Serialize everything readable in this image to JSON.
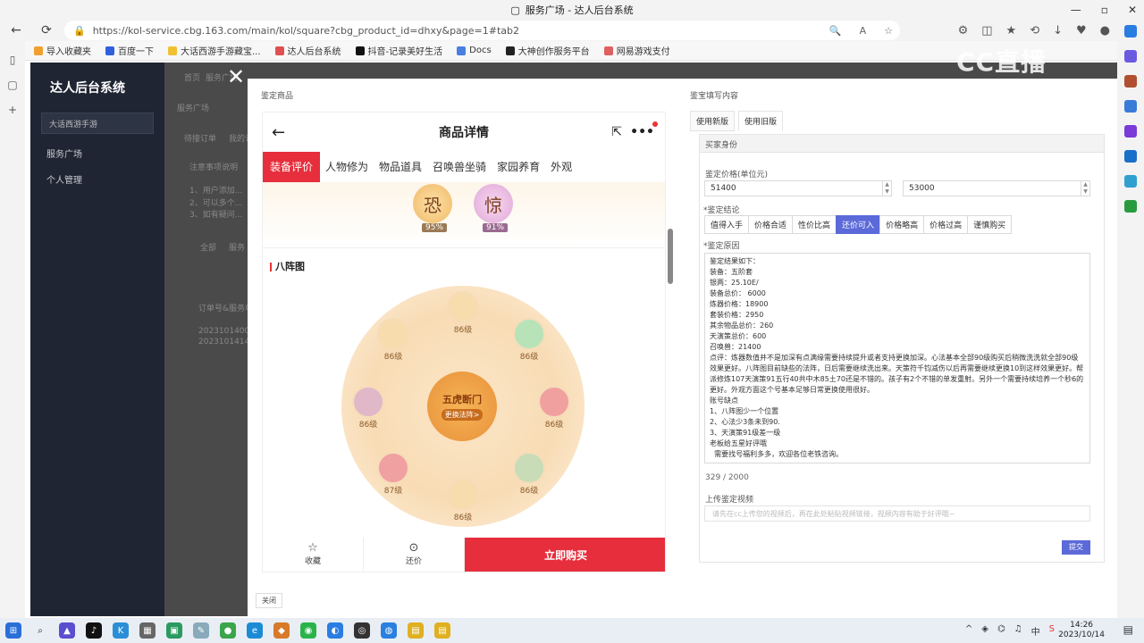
{
  "window": {
    "title": "服务广场 - 达人后台系统"
  },
  "browser": {
    "url": "https://kol-service.cbg.163.com/main/kol/square?cbg_product_id=dhxy&page=1#tab2",
    "bookmarks": [
      {
        "label": "导入收藏夹",
        "color": "#f0a030"
      },
      {
        "label": "百度一下",
        "color": "#3060e0"
      },
      {
        "label": "大话西游手游藏宝...",
        "color": "#f0c030"
      },
      {
        "label": "达人后台系统",
        "color": "#e05050"
      },
      {
        "label": "抖音-记录美好生活",
        "color": "#111111"
      },
      {
        "label": "Docs",
        "color": "#4a7ee0"
      },
      {
        "label": "大神创作服务平台",
        "color": "#222222"
      },
      {
        "label": "网易游戏支付",
        "color": "#e06060"
      }
    ]
  },
  "watermark": "CC直播",
  "sidebar": {
    "logo": "达人后台系统",
    "game_select": "大话西游手游",
    "items": [
      "服务广场",
      "个人管理"
    ]
  },
  "background_fragments": [
    "服务广场",
    "待接订单",
    "我的订",
    "注意事项说明",
    "1、用户添加...",
    "2、可以多个...",
    "3、如有疑问...",
    "全部",
    "服务",
    "订单号&服务单号",
    "2023101400...",
    "2023101414...",
    "首页",
    "服务广场",
    "待"
  ],
  "modal": {
    "left_title": "鉴定商品",
    "right_title": "鉴宝填写内容",
    "close_label": "关闭"
  },
  "phone": {
    "header_title": "商品详情",
    "tabs": [
      "装备评价",
      "人物修为",
      "物品道具",
      "召唤兽坐骑",
      "家园养育",
      "外观"
    ],
    "active_tab": 0,
    "emotions": [
      {
        "char": "恐",
        "pct": "95%"
      },
      {
        "char": "惊",
        "pct": "91%"
      }
    ],
    "section_title": "八阵图",
    "center": {
      "title": "五虎断门",
      "action": "更换法阵>"
    },
    "nodes": [
      "86级",
      "86级",
      "86级",
      "86级",
      "86级",
      "86级",
      "86级",
      "87级"
    ],
    "footer": {
      "fav": "收藏",
      "bargain": "还价",
      "buy": "立即购买"
    }
  },
  "form": {
    "tabs": [
      "使用新版",
      "使用旧版"
    ],
    "active_tab": 1,
    "panel_header": "买家身份",
    "price_label": "鉴定价格(单位元)",
    "price_min": "51400",
    "price_max": "53000",
    "conclusion_label": "*鉴定结论",
    "conclusion_options": [
      "值得入手",
      "价格合适",
      "性价比高",
      "还价可入",
      "价格略高",
      "价格过高",
      "谨慎购买"
    ],
    "conclusion_selected": 3,
    "reason_label": "*鉴定原因",
    "reason_text": "鉴定结果如下：\n装备：五阶套\n银两：25.10E/\n装备总价： 6000\n炼器价格：18900\n套装价格：2950\n其余物品总价：260\n天演策总价：600\n召唤兽：21400\n点评：炼器数值并不是加深有点满缘需要持续提升或者支持更换加深。心法基本全部90级购买后稍微洗洗就全部90级效果更好。八阵图目前缺些的法阵，日后需要继续洗出来。天策符千钧减伤以后再需要继续更换10到这样效果更好。帮派修炼107天演策91五行40共中木85土70还是不错的。孩子有2个不错的单发重射。另外一个需要持续培养一个秒6的更好。外观方面这个号基本足够日常更换使用很好。\n账号缺点\n1、八阵图少一个位置\n2、心法少3条未到90.\n3、天演策91级差一级\n老板给五星好评哦\n  需要找号福利多多，欢迎各位老铁咨询。",
    "counter": "329 / 2000",
    "upload_label": "上传鉴定视频",
    "upload_placeholder": "请先在cc上传您的视频后，再在此处粘贴视频链接，视频内容有助于好评哦~",
    "submit_label": "提交"
  },
  "taskbar": {
    "time": "14:26",
    "date": "2023/10/14",
    "tray_lang": "中"
  }
}
